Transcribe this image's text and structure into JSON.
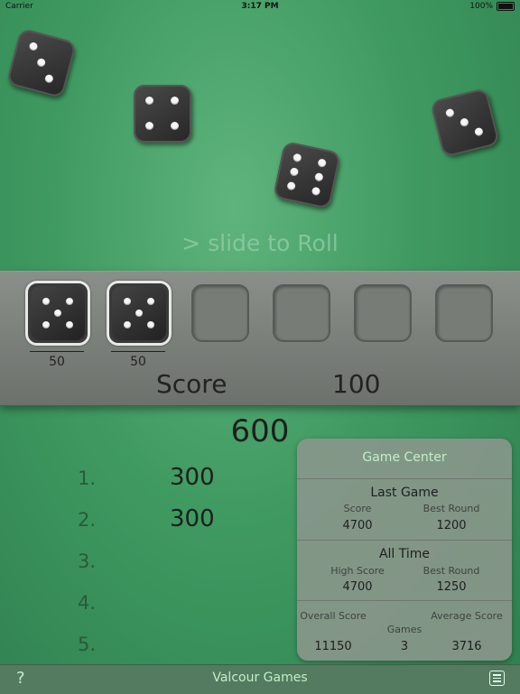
{
  "status": {
    "carrier": "Carrier",
    "time": "3:17 PM",
    "battery": "100%"
  },
  "hint": "> slide to Roll",
  "held_dice": [
    {
      "value": "50"
    },
    {
      "value": "50"
    }
  ],
  "score": {
    "label": "Score",
    "value": "100"
  },
  "total": "600",
  "rounds": [
    {
      "rank": "1.",
      "score": "300"
    },
    {
      "rank": "2.",
      "score": "300"
    },
    {
      "rank": "3.",
      "score": ""
    },
    {
      "rank": "4.",
      "score": ""
    },
    {
      "rank": "5.",
      "score": ""
    }
  ],
  "game_center": {
    "title": "Game Center",
    "last_game": {
      "heading": "Last Game",
      "score_label": "Score",
      "score": "4700",
      "best_round_label": "Best Round",
      "best_round": "1200"
    },
    "all_time": {
      "heading": "All Time",
      "high_score_label": "High Score",
      "high_score": "4700",
      "best_round_label": "Best Round",
      "best_round": "1250"
    },
    "overall": {
      "overall_label": "Overall Score",
      "overall": "11150",
      "games_label": "Games",
      "games": "3",
      "average_label": "Average Score",
      "average": "3716"
    }
  },
  "bottom": {
    "help": "?",
    "brand": "Valcour Games"
  }
}
